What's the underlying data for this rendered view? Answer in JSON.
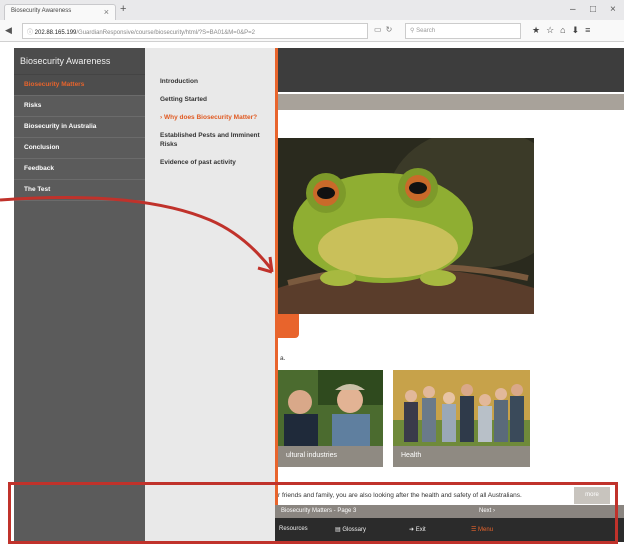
{
  "browser": {
    "tab_title": "Biosecurity Awareness",
    "tab_close": "×",
    "new_tab": "+",
    "win_min": "–",
    "win_max": "□",
    "win_close": "×",
    "url_host": "202.88.165.199",
    "url_path": "/GuardianResponsive/course/biosecurity/html/?S=BA01&M=0&P=2",
    "search_placeholder": "Search",
    "icons": [
      "back-arrow-icon",
      "info-icon",
      "reader-icon",
      "refresh-icon",
      "search-icon",
      "bookmark-star-icon",
      "library-icon",
      "home-icon",
      "download-icon",
      "menu-icon"
    ]
  },
  "sidebar": {
    "title": "Biosecurity Awareness",
    "items": [
      {
        "label": "Biosecurity Matters",
        "active": true
      },
      {
        "label": "Risks",
        "active": false
      },
      {
        "label": "Biosecurity in Australia",
        "active": false
      },
      {
        "label": "Conclusion",
        "active": false
      },
      {
        "label": "Feedback",
        "active": false
      },
      {
        "label": "The Test",
        "active": false
      }
    ]
  },
  "submenu": {
    "items": [
      {
        "label": "Introduction",
        "active": false
      },
      {
        "label": "Getting Started",
        "active": false
      },
      {
        "label": "› Why does Biosecurity Matter?",
        "active": true
      },
      {
        "label": "Established Pests and Imminent Risks",
        "active": false
      },
      {
        "label": "Evidence of past activity",
        "active": false
      }
    ],
    "collapse_label": "‹"
  },
  "content": {
    "intro_tail": "a.",
    "cards": [
      {
        "caption": "ultural industries"
      },
      {
        "caption": "Health"
      }
    ],
    "body_line": "r friends and family, you are also looking after the health and safety of all Australians.",
    "more_label": "more"
  },
  "pagebar": {
    "label": "Biosecurity Matters  -  Page 3",
    "next_label": "Next  ›"
  },
  "bottombar": {
    "resources": "Resources",
    "glossary": "Glossary",
    "exit": "Exit",
    "menu": "Menu"
  },
  "colors": {
    "accent": "#e8642c",
    "sidebar_bg": "#5b5b5b",
    "submenu_bg": "#e9e9e9",
    "annotation": "#c0322b"
  }
}
